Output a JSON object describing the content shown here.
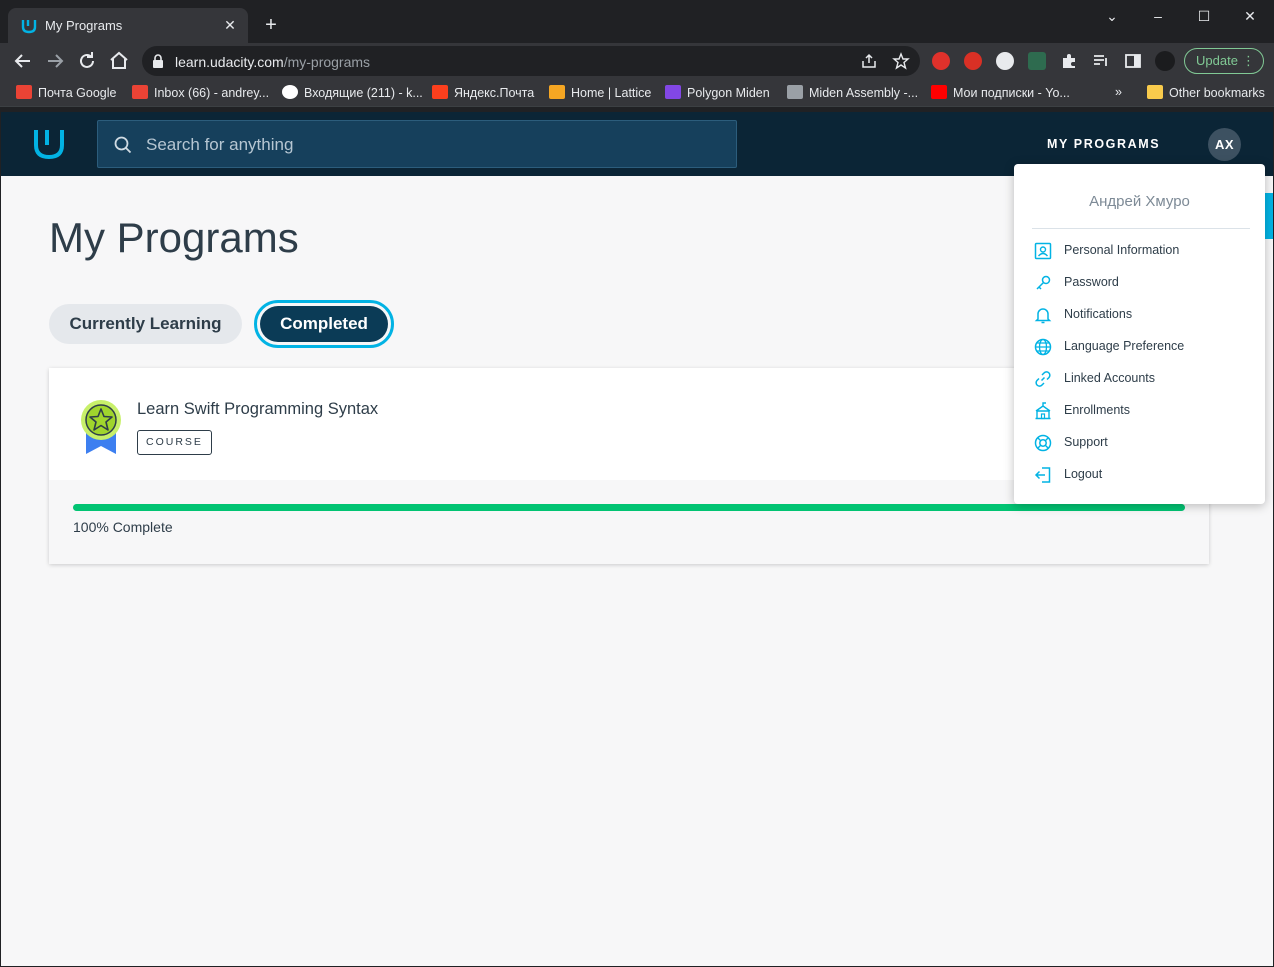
{
  "browser": {
    "tab_title": "My Programs",
    "url_host": "learn.udacity.com",
    "url_path": "/my-programs",
    "update_label": "Update",
    "bookmarks": [
      {
        "label": "Почта Google"
      },
      {
        "label": "Inbox (66) - andrey..."
      },
      {
        "label": "Входящие (211) - k..."
      },
      {
        "label": "Яндекс.Почта"
      },
      {
        "label": "Home | Lattice"
      },
      {
        "label": "Polygon Miden"
      },
      {
        "label": "Miden Assembly -..."
      },
      {
        "label": "Мои подписки - Yo..."
      }
    ],
    "other_bookmarks": "Other bookmarks",
    "overflow": "»"
  },
  "header": {
    "search_placeholder": "Search for anything",
    "my_programs": "MY PROGRAMS",
    "avatar_initials": "AX"
  },
  "main": {
    "title": "My Programs",
    "tabs": [
      {
        "label": "Currently Learning",
        "active": false
      },
      {
        "label": "Completed",
        "active": true
      }
    ],
    "course": {
      "title": "Learn Swift Programming Syntax",
      "tag": "COURSE",
      "progress": 100,
      "progress_text": "100% Complete"
    }
  },
  "dropdown": {
    "user_name": "Андрей Хмуро",
    "items": [
      {
        "label": "Personal Information",
        "icon": "id-card-icon"
      },
      {
        "label": "Password",
        "icon": "key-icon"
      },
      {
        "label": "Notifications",
        "icon": "bell-icon"
      },
      {
        "label": "Language Preference",
        "icon": "globe-icon"
      },
      {
        "label": "Linked Accounts",
        "icon": "link-icon"
      },
      {
        "label": "Enrollments",
        "icon": "school-icon"
      },
      {
        "label": "Support",
        "icon": "lifebuoy-icon"
      },
      {
        "label": "Logout",
        "icon": "logout-icon"
      }
    ]
  },
  "colors": {
    "accent": "#02b3e4",
    "header_bg": "#0b2536",
    "progress": "#02c473",
    "completed_pill": "#0b3b56"
  }
}
